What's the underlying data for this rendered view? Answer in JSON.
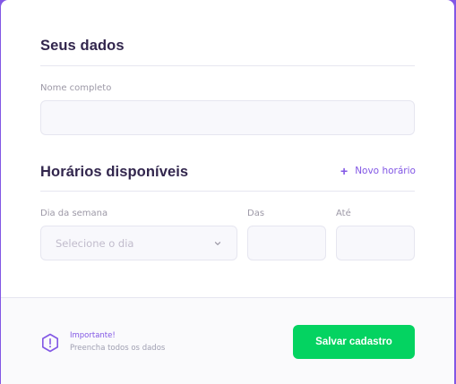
{
  "personal": {
    "title": "Seus dados",
    "name_label": "Nome completo",
    "name_value": ""
  },
  "schedule": {
    "title": "Horários disponíveis",
    "add_label": "Novo horário",
    "add_plus": "+",
    "weekday_label": "Dia da semana",
    "weekday_placeholder": "Selecione o dia",
    "from_label": "Das",
    "to_label": "Até"
  },
  "footer": {
    "warning_title": "Importante!",
    "warning_text": "Preencha todos os dados",
    "save_label": "Salvar cadastro"
  },
  "icons": {
    "warning": "warning-icon",
    "chevron": "chevron-down-icon",
    "plus": "plus-icon"
  },
  "colors": {
    "accent": "#8257e5",
    "save": "#04d361",
    "title": "#32264d"
  }
}
